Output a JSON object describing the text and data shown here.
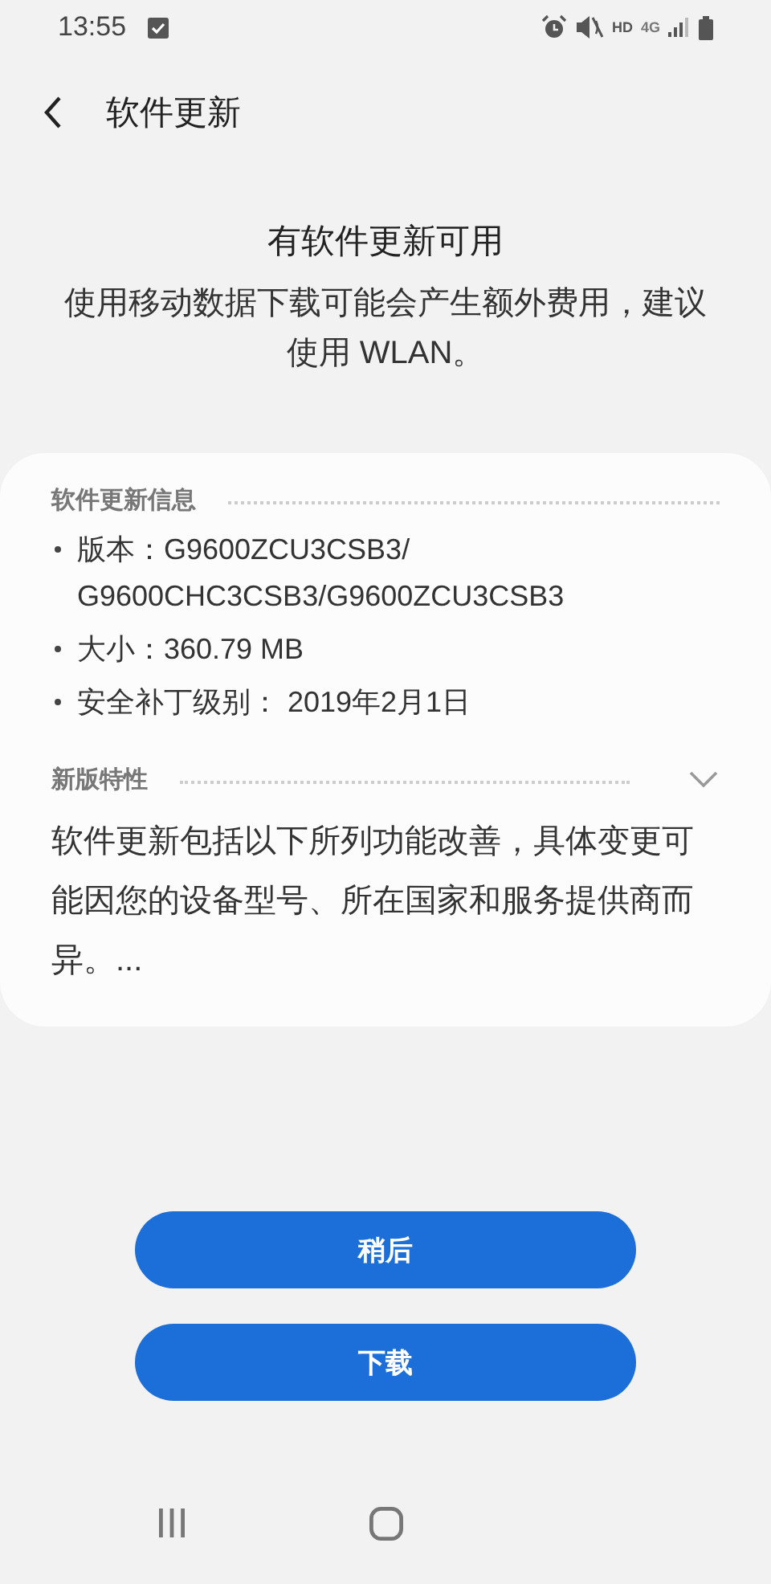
{
  "status_bar": {
    "time": "13:55",
    "hd": "HD",
    "network": "4G"
  },
  "header": {
    "title": "软件更新"
  },
  "notice": {
    "title": "有软件更新可用",
    "message": "使用移动数据下载可能会产生额外费用，建议使用 WLAN。"
  },
  "card": {
    "sections": [
      {
        "kind": "info",
        "title": "软件更新信息",
        "items": [
          "版本：G9600ZCU3CSB3/G9600CHC3CSB3/G9600ZCU3CSB3",
          "大小：360.79 MB",
          "安全补丁级别： 2019年2月1日"
        ]
      },
      {
        "kind": "features",
        "title": "新版特性",
        "expanded": false,
        "text": "软件更新包括以下所列功能改善，具体变更可能因您的设备型号、所在国家和服务提供商而异。..."
      }
    ]
  },
  "buttons": [
    "稍后",
    "下载"
  ]
}
